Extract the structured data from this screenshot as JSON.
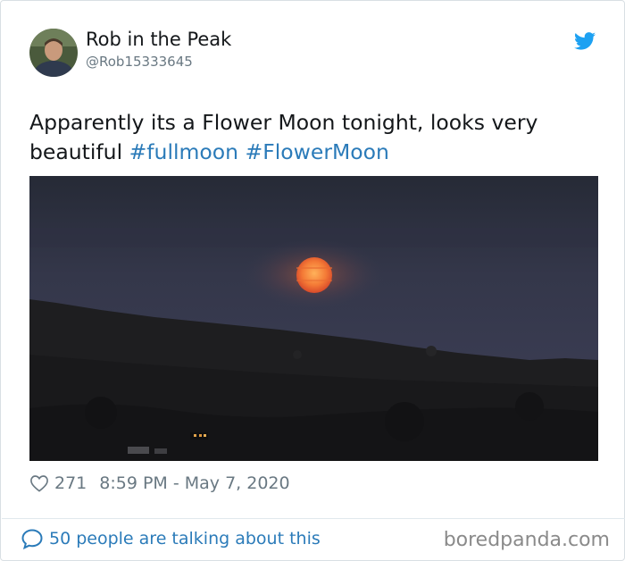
{
  "author": {
    "name": "Rob in the Peak",
    "handle": "@Rob15333645",
    "avatar_icon": "profile-photo"
  },
  "tweet": {
    "text": "Apparently its a Flower Moon tonight, looks very beautiful",
    "hashtags": [
      "#fullmoon",
      "#FlowerMoon"
    ],
    "hashtag_color": "#2b7bb9"
  },
  "media": {
    "icon": "full-moon-landscape-photo"
  },
  "meta": {
    "likes": "271",
    "timestamp": "8:59 PM - May 7, 2020"
  },
  "footer": {
    "talking_label": "50 people are talking about this",
    "source": "boredpanda.com"
  },
  "colors": {
    "accent": "#2b7bb9",
    "twitter_blue": "#1da1f2",
    "muted": "#697882"
  }
}
